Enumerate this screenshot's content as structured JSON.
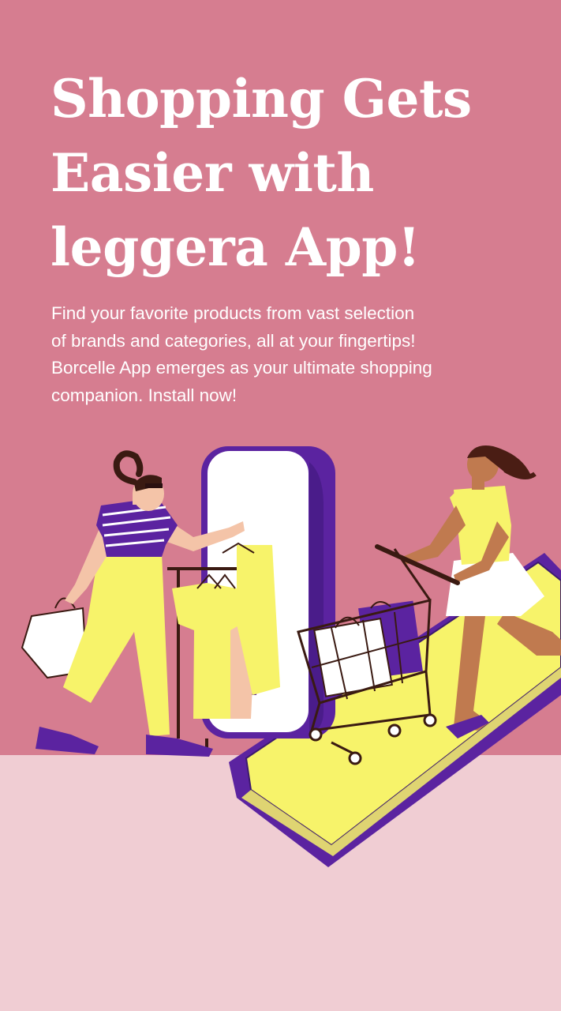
{
  "headline": {
    "lines": [
      "Shopping Gets",
      "Easier with",
      "leggera App!"
    ]
  },
  "body": {
    "lines": [
      "Find your favorite products from vast selection",
      "of brands and categories, all at your fingertips!",
      "Borcelle App emerges as your ultimate shopping",
      "companion. Install now!"
    ]
  },
  "colors": {
    "background_top": "#d67d90",
    "background_bottom": "#f0cdd3",
    "text": "#ffffff",
    "purple": "#5b23a0",
    "yellow": "#f7f36a",
    "skin_light": "#f4c4a8",
    "skin_dark": "#c07a4f",
    "hair_dark": "#4a1d14"
  },
  "illustration": {
    "subject": "two-women-shopping",
    "icons": [
      "shopping-bag-icon",
      "mirror-icon",
      "clothes-rack-icon",
      "shopping-cart-icon",
      "smartphone-icon"
    ]
  }
}
